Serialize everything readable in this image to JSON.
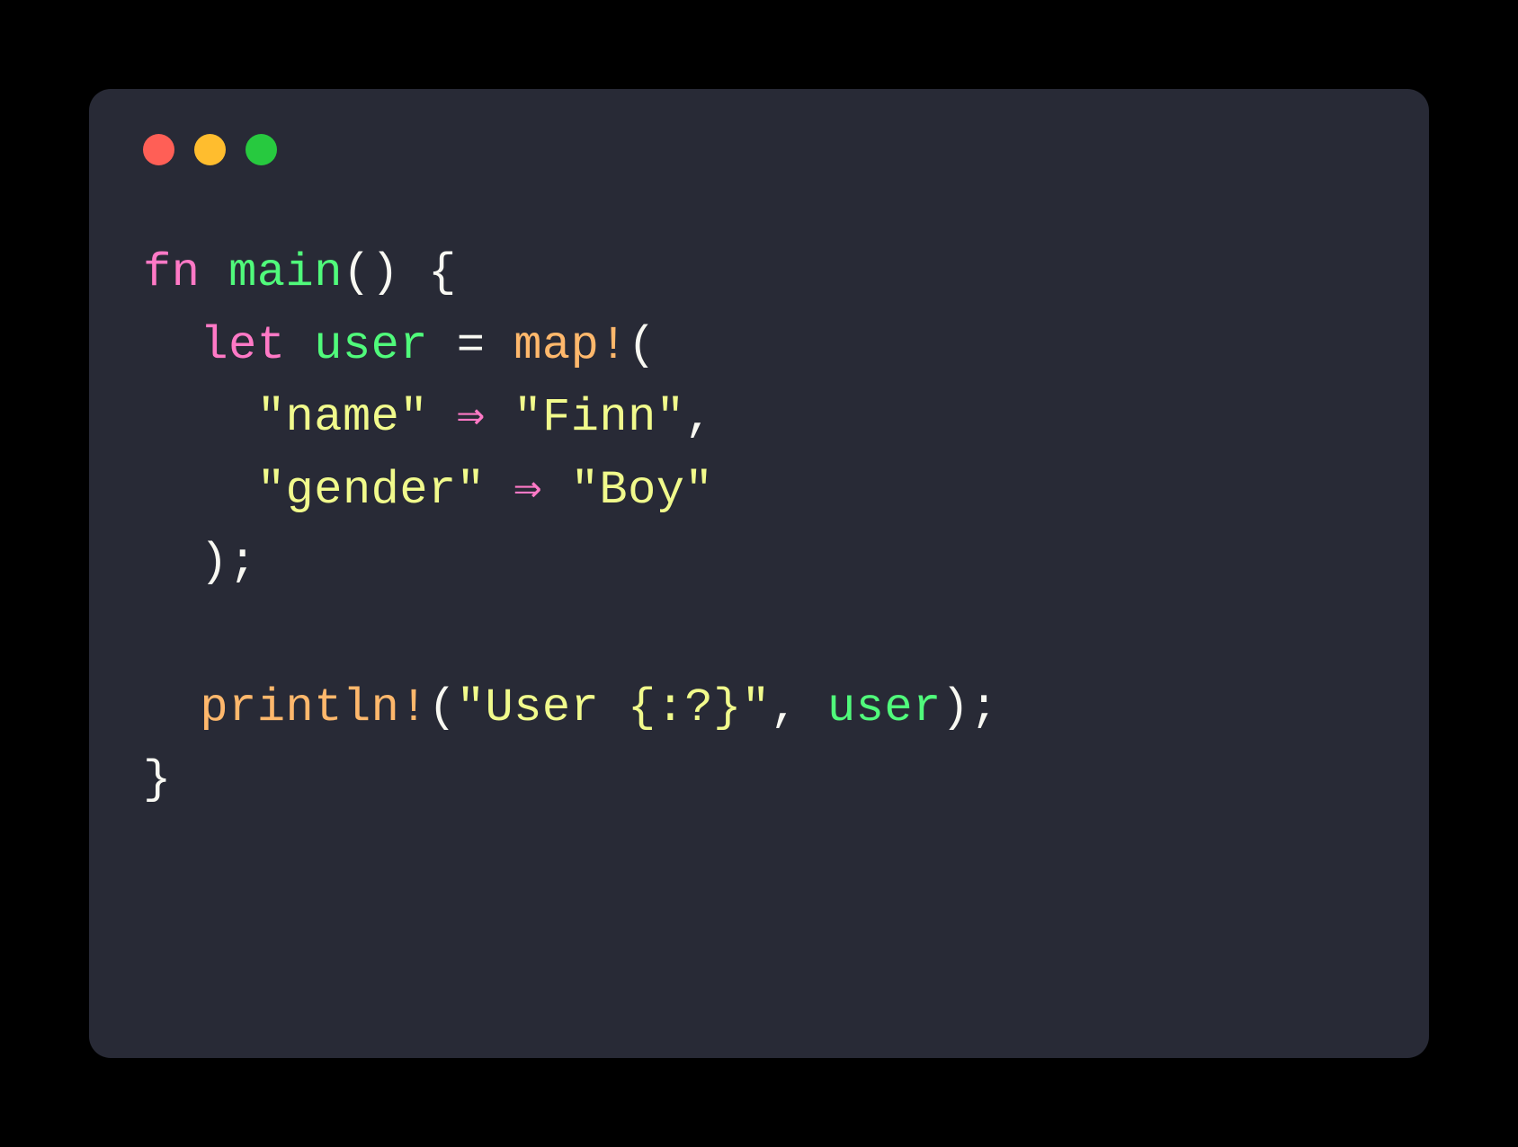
{
  "colors": {
    "background": "#000000",
    "window_bg": "#282a36",
    "traffic_red": "#ff5f56",
    "traffic_yellow": "#ffbd2e",
    "traffic_green": "#27c93f",
    "keyword": "#ff79c6",
    "function": "#50fa7b",
    "macro": "#ffb86c",
    "string": "#f1fa8c",
    "punct": "#f8f8f2"
  },
  "code": {
    "tokens": {
      "fn": "fn",
      "main": "main",
      "open_paren1": "()",
      "open_brace": " {",
      "let": "let",
      "user_var": "user",
      "equals": " = ",
      "map_macro": "map!",
      "open_paren2": "(",
      "name_key": "\"name\"",
      "arrow1": " ⇒ ",
      "name_val": "\"Finn\"",
      "comma1": ",",
      "gender_key": "\"gender\"",
      "arrow2": " ⇒ ",
      "gender_val": "\"Boy\"",
      "close_paren1": ");",
      "println_macro": "println!",
      "open_paren3": "(",
      "fmt_string": "\"User {:?}\"",
      "comma2": ", ",
      "user_ref": "user",
      "close_paren2": ");",
      "close_brace": "}"
    },
    "indent1": "  ",
    "indent2": "    "
  }
}
